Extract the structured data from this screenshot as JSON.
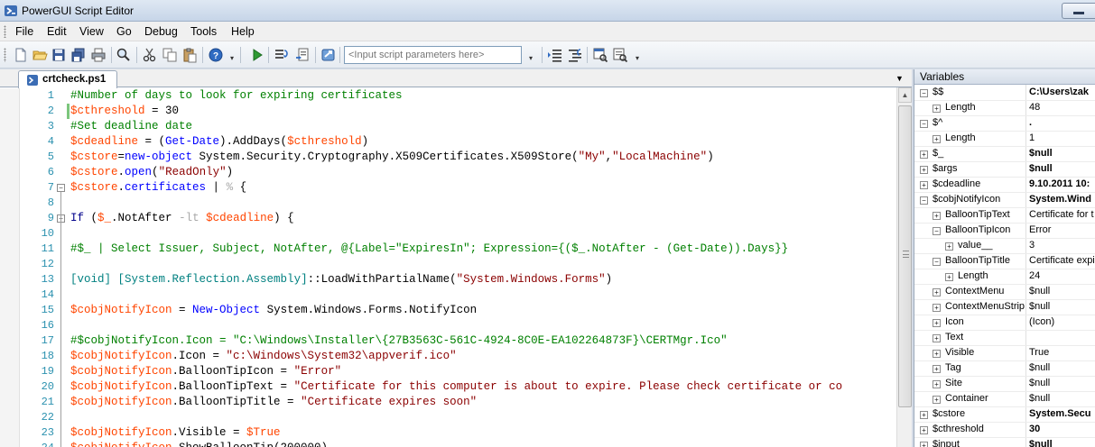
{
  "window": {
    "title": "PowerGUI Script Editor"
  },
  "menu": [
    "File",
    "Edit",
    "View",
    "Go",
    "Debug",
    "Tools",
    "Help"
  ],
  "toolbar": {
    "params_placeholder": "<Input script parameters here>"
  },
  "tab": {
    "filename": "crtcheck.ps1"
  },
  "code": {
    "line_numbers": [
      "1",
      "2",
      "3",
      "4",
      "5",
      "6",
      "7",
      "8",
      "9",
      "10",
      "11",
      "12",
      "13",
      "14",
      "15",
      "16",
      "17",
      "18",
      "19",
      "20",
      "21",
      "22",
      "23",
      "24"
    ],
    "lines": [
      [
        [
          "c",
          "#Number of days to look for expiring certificates"
        ]
      ],
      [
        [
          "v",
          "$cthreshold"
        ],
        [
          "p",
          " = 30"
        ]
      ],
      [
        [
          "c",
          "#Set deadline date"
        ]
      ],
      [
        [
          "v",
          "$cdeadline"
        ],
        [
          "p",
          " = ("
        ],
        [
          "k",
          "Get-Date"
        ],
        [
          "p",
          ").AddDays("
        ],
        [
          "v",
          "$cthreshold"
        ],
        [
          "p",
          ")"
        ]
      ],
      [
        [
          "v",
          "$cstore"
        ],
        [
          "p",
          "="
        ],
        [
          "k",
          "new-object"
        ],
        [
          "p",
          " System.Security.Cryptography.X509Certificates.X509Store("
        ],
        [
          "s",
          "\"My\""
        ],
        [
          "p",
          ","
        ],
        [
          "s",
          "\"LocalMachine\""
        ],
        [
          "p",
          ")"
        ]
      ],
      [
        [
          "v",
          "$cstore"
        ],
        [
          "p",
          "."
        ],
        [
          "k",
          "open"
        ],
        [
          "p",
          "("
        ],
        [
          "s",
          "\"ReadOnly\""
        ],
        [
          "p",
          ")"
        ]
      ],
      [
        [
          "v",
          "$cstore"
        ],
        [
          "p",
          "."
        ],
        [
          "k",
          "certificates"
        ],
        [
          "p",
          " | "
        ],
        [
          "o",
          "%"
        ],
        [
          "p",
          " {"
        ]
      ],
      [
        [
          "p",
          ""
        ]
      ],
      [
        [
          "w",
          "If"
        ],
        [
          "p",
          " ("
        ],
        [
          "v",
          "$_"
        ],
        [
          "p",
          ".NotAfter "
        ],
        [
          "o",
          "-lt"
        ],
        [
          "p",
          " "
        ],
        [
          "v",
          "$cdeadline"
        ],
        [
          "p",
          ") {"
        ]
      ],
      [
        [
          "p",
          ""
        ]
      ],
      [
        [
          "c",
          "#$_ | Select Issuer, Subject, NotAfter, @{Label=\"ExpiresIn\"; Expression={($_.NotAfter - (Get-Date)).Days}}"
        ]
      ],
      [
        [
          "p",
          ""
        ]
      ],
      [
        [
          "t",
          "[void]"
        ],
        [
          "p",
          " "
        ],
        [
          "t",
          "[System.Reflection.Assembly]"
        ],
        [
          "p",
          "::LoadWithPartialName("
        ],
        [
          "s",
          "\"System.Windows.Forms\""
        ],
        [
          "p",
          ")"
        ]
      ],
      [
        [
          "p",
          ""
        ]
      ],
      [
        [
          "v",
          "$cobjNotifyIcon"
        ],
        [
          "p",
          " = "
        ],
        [
          "k",
          "New-Object"
        ],
        [
          "p",
          " System.Windows.Forms.NotifyIcon"
        ]
      ],
      [
        [
          "p",
          ""
        ]
      ],
      [
        [
          "c",
          "#$cobjNotifyIcon.Icon = \"C:\\Windows\\Installer\\{27B3563C-561C-4924-8C0E-EA102264873F}\\CERTMgr.Ico\""
        ]
      ],
      [
        [
          "v",
          "$cobjNotifyIcon"
        ],
        [
          "p",
          ".Icon = "
        ],
        [
          "s",
          "\"c:\\Windows\\System32\\appverif.ico\""
        ]
      ],
      [
        [
          "v",
          "$cobjNotifyIcon"
        ],
        [
          "p",
          ".BalloonTipIcon = "
        ],
        [
          "s",
          "\"Error\""
        ]
      ],
      [
        [
          "v",
          "$cobjNotifyIcon"
        ],
        [
          "p",
          ".BalloonTipText = "
        ],
        [
          "s",
          "\"Certificate for this computer is about to expire. Please check certificate or co"
        ]
      ],
      [
        [
          "v",
          "$cobjNotifyIcon"
        ],
        [
          "p",
          ".BalloonTipTitle = "
        ],
        [
          "s",
          "\"Certificate expires soon\""
        ]
      ],
      [
        [
          "p",
          ""
        ]
      ],
      [
        [
          "v",
          "$cobjNotifyIcon"
        ],
        [
          "p",
          ".Visible = "
        ],
        [
          "v",
          "$True"
        ]
      ],
      [
        [
          "v",
          "$cobjNotifyIcon"
        ],
        [
          "p",
          ".ShowBalloonTip(200000)"
        ]
      ]
    ]
  },
  "variables": {
    "title": "Variables",
    "rows": [
      {
        "level": 0,
        "exp": "−",
        "name": "$$",
        "value": "C:\\Users\\zak",
        "bold": true
      },
      {
        "level": 1,
        "exp": "+",
        "name": "Length",
        "value": "48",
        "bold": false
      },
      {
        "level": 0,
        "exp": "−",
        "name": "$^",
        "value": ".",
        "bold": true
      },
      {
        "level": 1,
        "exp": "+",
        "name": "Length",
        "value": "1",
        "bold": false
      },
      {
        "level": 0,
        "exp": "+",
        "name": "$_",
        "value": "$null",
        "bold": true
      },
      {
        "level": 0,
        "exp": "+",
        "name": "$args",
        "value": "$null",
        "bold": true
      },
      {
        "level": 0,
        "exp": "+",
        "name": "$cdeadline",
        "value": "9.10.2011 10:",
        "bold": true
      },
      {
        "level": 0,
        "exp": "−",
        "name": "$cobjNotifyIcon",
        "value": "System.Wind",
        "bold": true
      },
      {
        "level": 1,
        "exp": "+",
        "name": "BalloonTipText",
        "value": "Certificate for t",
        "bold": false
      },
      {
        "level": 1,
        "exp": "−",
        "name": "BalloonTipIcon",
        "value": "Error",
        "bold": false
      },
      {
        "level": 2,
        "exp": "+",
        "name": "value__",
        "value": "3",
        "bold": false
      },
      {
        "level": 1,
        "exp": "−",
        "name": "BalloonTipTitle",
        "value": "Certificate expi",
        "bold": false
      },
      {
        "level": 2,
        "exp": "+",
        "name": "Length",
        "value": "24",
        "bold": false
      },
      {
        "level": 1,
        "exp": "+",
        "name": "ContextMenu",
        "value": "$null",
        "bold": false
      },
      {
        "level": 1,
        "exp": "+",
        "name": "ContextMenuStrip",
        "value": "$null",
        "bold": false
      },
      {
        "level": 1,
        "exp": "+",
        "name": "Icon",
        "value": "(Icon)",
        "bold": false
      },
      {
        "level": 1,
        "exp": "+",
        "name": "Text",
        "value": "",
        "bold": false
      },
      {
        "level": 1,
        "exp": "+",
        "name": "Visible",
        "value": "True",
        "bold": false
      },
      {
        "level": 1,
        "exp": "+",
        "name": "Tag",
        "value": "$null",
        "bold": false
      },
      {
        "level": 1,
        "exp": "+",
        "name": "Site",
        "value": "$null",
        "bold": false
      },
      {
        "level": 1,
        "exp": "+",
        "name": "Container",
        "value": "$null",
        "bold": false
      },
      {
        "level": 0,
        "exp": "+",
        "name": "$cstore",
        "value": "System.Secu",
        "bold": true
      },
      {
        "level": 0,
        "exp": "+",
        "name": "$cthreshold",
        "value": "30",
        "bold": true
      },
      {
        "level": 0,
        "exp": "+",
        "name": "$input",
        "value": "$null",
        "bold": true
      }
    ]
  },
  "colors": {
    "comment": "#008000",
    "variable": "#ff4500",
    "command": "#0000ff",
    "string": "#8b0000",
    "line_number": "#2b91af"
  }
}
